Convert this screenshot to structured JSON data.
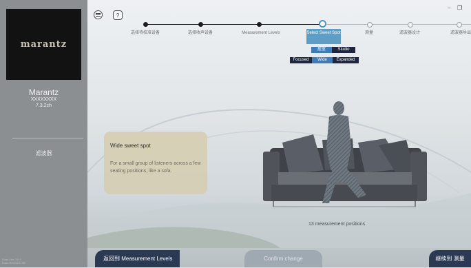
{
  "sidebar": {
    "brand_logo": "marantz",
    "device_name": "Marantz",
    "device_model": "XXXXXXXX",
    "device_channels": "7.3.2ch",
    "nav_filter": "滤波器",
    "footer_line1": "Dirac Live 3.6.4",
    "footer_line2": "Dirac Research AB"
  },
  "toolbar": {
    "menu_icon": "menu-icon",
    "help_label": "?",
    "minimize": "–",
    "maximize": "❐"
  },
  "steps": [
    {
      "label": "选择待校准设备",
      "state": "done"
    },
    {
      "label": "选择收声设备",
      "state": "done"
    },
    {
      "label": "Measurement Levels",
      "state": "done"
    },
    {
      "label": "Select Sweet Spot",
      "state": "current"
    },
    {
      "label": "测量",
      "state": "pending"
    },
    {
      "label": "滤波器设计",
      "state": "pending"
    },
    {
      "label": "滤波器导出",
      "state": "pending"
    }
  ],
  "listening_mode": {
    "options": [
      "居室",
      "Studio"
    ],
    "selected": "居室"
  },
  "spot_type": {
    "options": [
      "Focused",
      "Wide",
      "Expanded"
    ],
    "selected": "Wide"
  },
  "info_card": {
    "title": "Wide sweet spot",
    "body": "For a small group of listeners across a few seating positions, like a sofa."
  },
  "scene": {
    "positions_label": "13 measurement positions"
  },
  "footer": {
    "back_label": "返回到 Measurement Levels",
    "confirm_label": "Confirm change",
    "next_label": "继续到 测量"
  },
  "colors": {
    "sidebar": "#8c8f92",
    "accent": "#5c9ec6",
    "footer_button": "#2b3952",
    "info_card": "#d6cfb4"
  }
}
